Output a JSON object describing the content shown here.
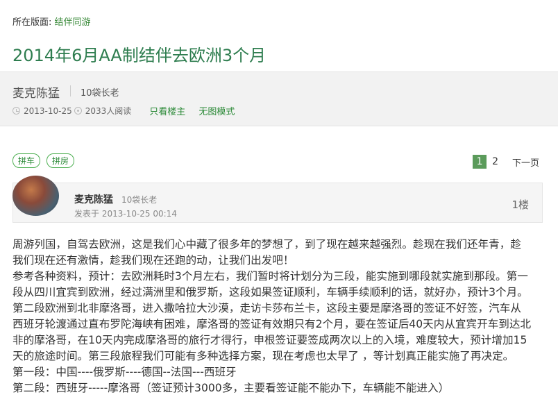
{
  "breadcrumb": {
    "label": "所在版面:",
    "forum": "结伴同游"
  },
  "title": "2014年6月AA制结伴去欧洲3个月",
  "author": {
    "name": "麦克陈猛",
    "level": "10袋长老",
    "date": "2013-10-25",
    "views": "2033人阅读",
    "only_op_label": "只看楼主",
    "no_image_label": "无图模式"
  },
  "tags": [
    "拼车",
    "拼房"
  ],
  "pagination": {
    "current": "1",
    "pages": [
      "2"
    ],
    "next": "下一页"
  },
  "first_floor": {
    "author": "麦克陈猛",
    "level": "10袋长老",
    "posted_at": "发表于 2013-10-25 00:14",
    "floor": "1楼"
  },
  "body_lines": [
    "周游列国，自驾去欧洲，这是我们心中藏了很多年的梦想了，到了现在越来越强烈。趁现在我们还年青，趁",
    "我们现在还有激情，趁我们现在还跑的动，让我们出发吧！",
    "参考各种资料，预计：去欧洲耗时3个月左右，我们暂时将计划分为三段，能实施到哪段就实施到那段。第一",
    "段从四川宜宾到欧洲，经过满洲里和俄罗斯，这段如果签证顺利，车辆手续顺利的话，就好办，预计3个月。",
    "第二段欧洲到北非摩洛哥，进入撒哈拉大沙漠，走访卡莎布兰卡，这段主要是摩洛哥的签证不好签，汽车从",
    "西班牙轮渡通过直布罗陀海峡有困难，摩洛哥的签证有效期只有2个月，要在签证后40天内从宜宾开车到达北",
    "非的摩洛哥，在10天内完成摩洛哥的旅行才得行，申根签证要签成两次以上的入境，难度较大，预计增加15",
    "天的旅途时间。第三段旅程我们可能有多种选择方案，现在考虑也太早了 ，等计划真正能实施了再决定。",
    "第一段：中国----俄罗斯----德国--法国---西班牙",
    "第二段：西班牙-----摩洛哥（签证预计3000多，主要看签证能不能办下，车辆能不能进入）"
  ]
}
